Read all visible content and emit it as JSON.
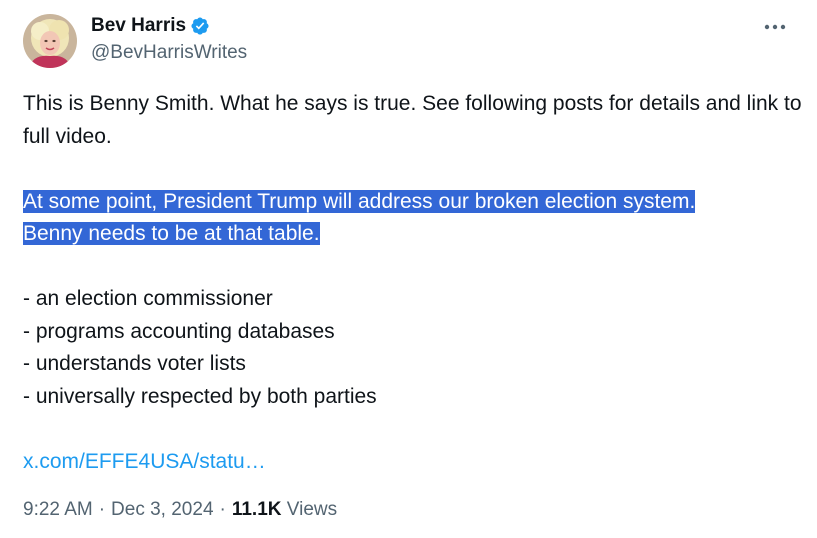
{
  "author": {
    "display_name": "Bev Harris",
    "handle": "@BevHarrisWrites",
    "verified_icon": "verified-badge-icon",
    "verified_color": "#1d9bf0"
  },
  "menu": {
    "icon": "more-horizontal-icon"
  },
  "post": {
    "intro": "This is Benny Smith. What he says is true. See following posts for details and link to full video.",
    "highlighted_line_1": "At some point, President Trump will address our broken election system.",
    "highlighted_line_2": "Benny needs to be at that table.",
    "bullets": [
      "- an election commissioner",
      "- programs accounting databases",
      "- understands voter lists",
      "- universally respected by both parties"
    ],
    "link": "x.com/EFFE4USA/statu…"
  },
  "meta": {
    "time": "9:22 AM",
    "separator": "·",
    "date": "Dec 3, 2024",
    "views_count": "11.1K",
    "views_label": "Views"
  },
  "colors": {
    "text": "#0f1419",
    "secondary": "#536471",
    "link": "#1d9bf0",
    "selection": "#3367d6"
  }
}
